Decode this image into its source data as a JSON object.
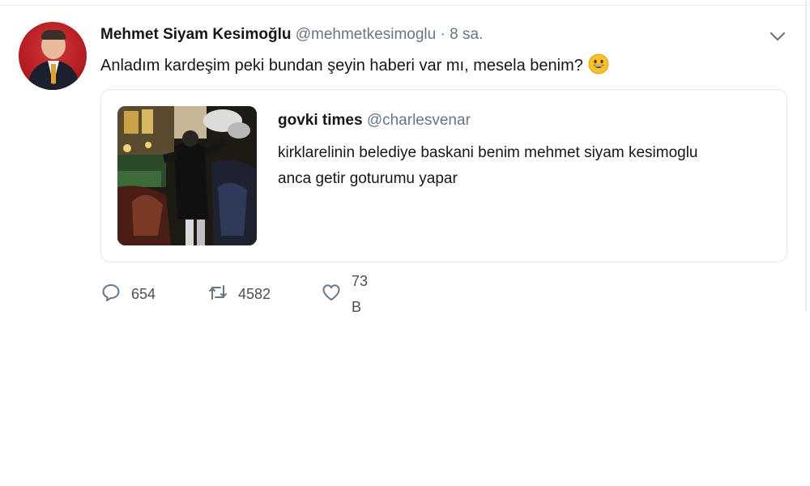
{
  "tweet": {
    "author": {
      "display_name": "Mehmet Siyam Kesimoğlu",
      "handle": "@mehmetkesimoglu",
      "separator": "·",
      "time": "8 sa."
    },
    "text": "Anladım kardeşim peki bundan şeyin haberi var mı, mesela benim?",
    "emoji_icon": "grinning-face-icon",
    "quoted_tweet": {
      "display_name": "govki times",
      "handle": "@charlesvenar",
      "text": "kirklarelinin belediye baskani benim mehmet siyam kesimoglu anca getir goturumu yapar"
    },
    "actions": {
      "reply": {
        "icon": "reply-icon",
        "count": "654"
      },
      "retweet": {
        "icon": "retweet-icon",
        "count": "4582"
      },
      "like": {
        "icon": "heart-icon",
        "count": "73 B"
      }
    }
  },
  "colors": {
    "text_primary": "#14171a",
    "text_secondary": "#657786",
    "border": "#e1e8ed",
    "avatar_background": "#b81f24"
  }
}
